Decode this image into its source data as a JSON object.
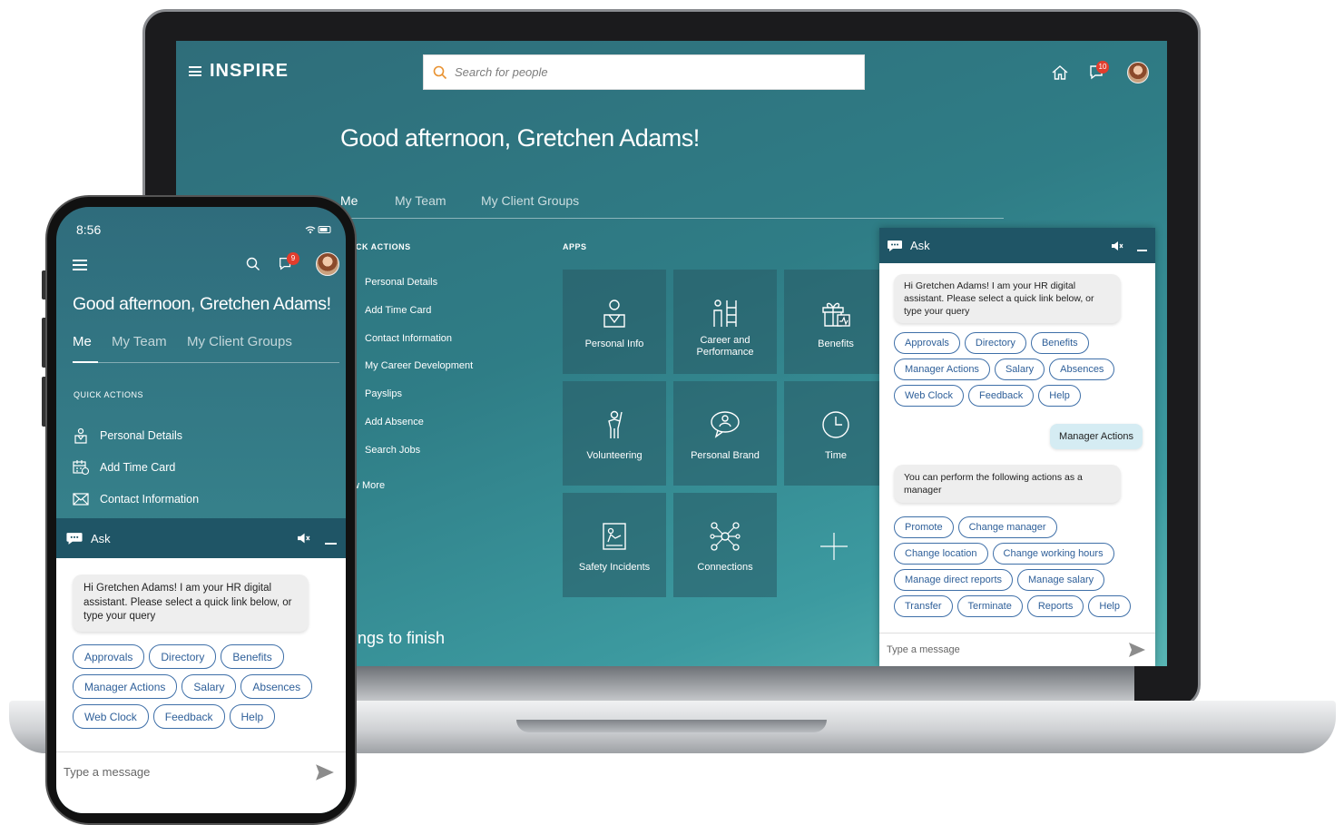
{
  "desktop": {
    "logo": "INSPIRE",
    "search_placeholder": "Search for people",
    "notification_count": "10",
    "greeting": "Good afternoon, Gretchen Adams!",
    "tabs": [
      "Me",
      "My Team",
      "My Client Groups"
    ],
    "quick_actions_title": "CK ACTIONS",
    "quick_actions": [
      "Personal Details",
      "Add Time Card",
      "Contact Information",
      "My Career Development",
      "Payslips",
      "Add Absence",
      "Search Jobs"
    ],
    "show_more": "w More",
    "apps_title": "APPS",
    "apps": [
      {
        "label": "Personal Info",
        "icon": "person-badge-icon"
      },
      {
        "label": "Career and Performance",
        "icon": "career-ladder-icon"
      },
      {
        "label": "Benefits",
        "icon": "gift-icon"
      },
      {
        "label": "Volunteering",
        "icon": "volunteer-icon"
      },
      {
        "label": "Personal Brand",
        "icon": "speech-person-icon"
      },
      {
        "label": "Time",
        "icon": "clock-icon"
      },
      {
        "label": "Safety Incidents",
        "icon": "safety-clipboard-icon"
      },
      {
        "label": "Connections",
        "icon": "network-icon"
      }
    ],
    "things_to_finish": "ings to finish",
    "chat": {
      "title": "Ask",
      "greeting_message": "Hi Gretchen Adams! I am your HR digital assistant. Please select a quick link below, or type your query",
      "quick_links": [
        [
          "Approvals",
          "Directory",
          "Benefits"
        ],
        [
          "Manager Actions",
          "Salary",
          "Absences"
        ],
        [
          "Web Clock",
          "Feedback",
          "Help"
        ]
      ],
      "user_message": "Manager Actions",
      "reply_message": "You can perform the following actions as a manager",
      "manager_links": [
        [
          "Promote",
          "Change manager"
        ],
        [
          "Change location",
          "Change working hours"
        ],
        [
          "Manage direct reports",
          "Manage salary"
        ],
        [
          "Transfer",
          "Terminate",
          "Reports",
          "Help"
        ]
      ],
      "input_placeholder": "Type a message"
    }
  },
  "phone": {
    "time": "8:56",
    "notification_count": "9",
    "greeting": "Good afternoon, Gretchen Adams!",
    "tabs": [
      "Me",
      "My Team",
      "My Client Groups"
    ],
    "quick_actions_title": "QUICK ACTIONS",
    "quick_actions": [
      "Personal Details",
      "Add Time Card",
      "Contact Information"
    ],
    "chat": {
      "title": "Ask",
      "greeting_message": "Hi Gretchen Adams! I am your HR digital assistant. Please select a quick link below, or type your query",
      "quick_links": [
        [
          "Approvals",
          "Directory",
          "Benefits"
        ],
        [
          "Manager Actions",
          "Salary",
          "Absences"
        ],
        [
          "Web Clock",
          "Feedback",
          "Help"
        ]
      ],
      "input_placeholder": "Type a message"
    }
  },
  "colors": {
    "chat_header": "#1f5566",
    "chip_border": "#3e6fa8",
    "badge": "#e23d2d",
    "teal_bg": "#2f7d86"
  }
}
